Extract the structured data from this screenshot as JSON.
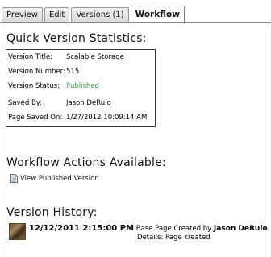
{
  "tabs": [
    {
      "label": "Preview"
    },
    {
      "label": "Edit"
    },
    {
      "label": "Versions (1)"
    },
    {
      "label": "Workflow"
    }
  ],
  "quick_stats": {
    "title": "Quick Version Statistics:",
    "rows": [
      {
        "label": "Version Title:",
        "value": "Scalable Storage"
      },
      {
        "label": "Version Number:",
        "value": "515"
      },
      {
        "label": "Version Status:",
        "value": "Published"
      },
      {
        "label": "Saved By:",
        "value": "Jason DeRulo"
      },
      {
        "label": "Page Saved On:",
        "value": "1/27/2012 10:09:14 AM"
      }
    ],
    "status_color": "#2fa52f"
  },
  "workflow": {
    "title": "Workflow Actions Available:",
    "action_label": "View Published Version",
    "action_icon": "document-icon"
  },
  "history": {
    "title": "Version History:",
    "entries": [
      {
        "date": "12/12/2011 2:15:00 PM",
        "description_prefix": "- Base Page Created by",
        "author": "Jason DeRulo",
        "details": "Details: Page created"
      }
    ]
  }
}
